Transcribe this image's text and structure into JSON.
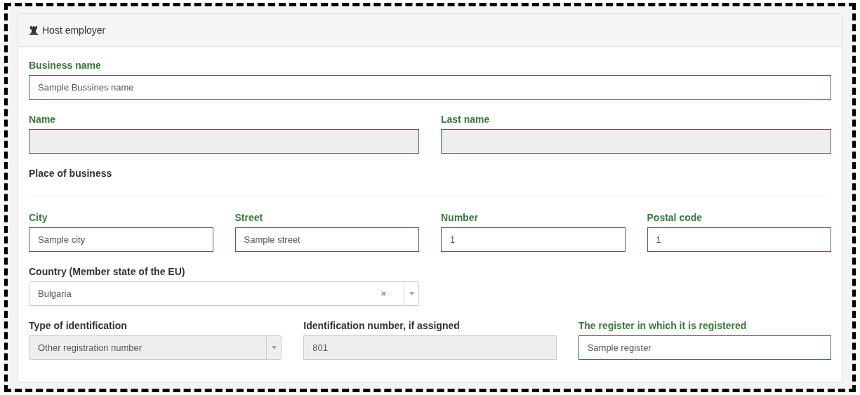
{
  "panel": {
    "title": "Host employer"
  },
  "rows": [
    {
      "kind": "fields",
      "fields": [
        {
          "kind": "text",
          "label": "Business name",
          "value": "Sample Bussines name",
          "valid": true,
          "disabled": false
        }
      ]
    },
    {
      "kind": "fields",
      "fields": [
        {
          "kind": "text",
          "label": "Name",
          "valid": true,
          "disabled": true
        },
        {
          "kind": "text",
          "label": "Last name",
          "valid": true,
          "disabled": true
        }
      ]
    },
    {
      "kind": "heading",
      "text": "Place of business"
    },
    {
      "kind": "fields",
      "fields": [
        {
          "kind": "text",
          "label": "City",
          "value": "Sample city",
          "valid": true,
          "disabled": false
        },
        {
          "kind": "text",
          "label": "Street",
          "value": "Sample street",
          "valid": true,
          "disabled": false
        },
        {
          "kind": "text",
          "label": "Number",
          "value": "1",
          "valid": true,
          "disabled": false
        },
        {
          "kind": "text",
          "label": "Postal code",
          "value": "1",
          "valid": true,
          "disabled": false
        }
      ]
    },
    {
      "kind": "fields",
      "fields": [
        {
          "kind": "select",
          "label": "Country (Member state of the EU)",
          "value": "Bulgaria",
          "valid": false,
          "disabled": false,
          "clearable": true
        }
      ]
    },
    {
      "kind": "fields",
      "fields": [
        {
          "kind": "select",
          "label": "Type of identification",
          "value": "Other registration number",
          "valid": false,
          "disabled": true,
          "clearable": false
        },
        {
          "kind": "text",
          "label": "Identification number, if assigned",
          "value": "801",
          "valid": false,
          "disabled": true
        },
        {
          "kind": "text",
          "label": "The register in which it is registered",
          "value": "Sample register",
          "valid": true,
          "disabled": false
        }
      ]
    }
  ]
}
